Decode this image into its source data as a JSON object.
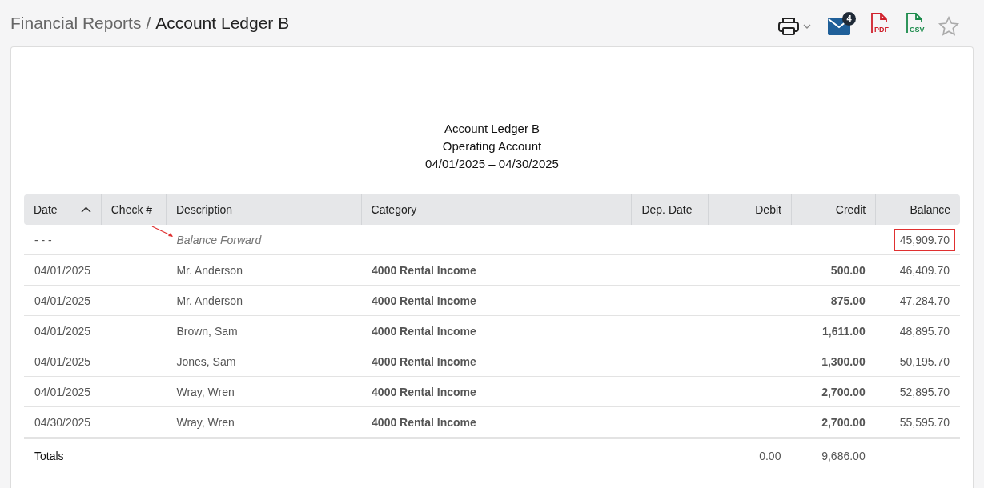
{
  "breadcrumb": {
    "parent": "Financial Reports",
    "separator": "/",
    "current": "Account Ledger B"
  },
  "toolbar": {
    "mail_count": "4",
    "pdf_label": "PDF",
    "csv_label": "CSV",
    "favorite": false
  },
  "report": {
    "title": "Account Ledger B",
    "subtitle": "Operating Account",
    "period": "04/01/2025 – 04/30/2025"
  },
  "table": {
    "columns": [
      {
        "label": "Date",
        "sorted": true
      },
      {
        "label": "Check #",
        "sorted": false
      },
      {
        "label": "Description",
        "sorted": false
      },
      {
        "label": "Category",
        "sorted": false
      },
      {
        "label": "Dep. Date",
        "sorted": false
      },
      {
        "label": "Debit",
        "sorted": false
      },
      {
        "label": "Credit",
        "sorted": false
      },
      {
        "label": "Balance",
        "sorted": false
      }
    ],
    "rows": [
      {
        "kind": "forward",
        "date": "- - -",
        "description": "Balance Forward",
        "balance": "45,909.70",
        "highlighted": true
      },
      {
        "kind": "entry",
        "date": "04/01/2025",
        "description": "Mr. Anderson",
        "category": "4000 Rental Income",
        "credit": "500.00",
        "balance": "46,409.70",
        "highlighted": false
      },
      {
        "kind": "entry",
        "date": "04/01/2025",
        "description": "Mr. Anderson",
        "category": "4000 Rental Income",
        "credit": "875.00",
        "balance": "47,284.70",
        "highlighted": false
      },
      {
        "kind": "entry",
        "date": "04/01/2025",
        "description": "Brown, Sam",
        "category": "4000 Rental Income",
        "credit": "1,611.00",
        "balance": "48,895.70",
        "highlighted": false
      },
      {
        "kind": "entry",
        "date": "04/01/2025",
        "description": "Jones, Sam",
        "category": "4000 Rental Income",
        "credit": "1,300.00",
        "balance": "50,195.70",
        "highlighted": false
      },
      {
        "kind": "entry",
        "date": "04/01/2025",
        "description": "Wray, Wren",
        "category": "4000 Rental Income",
        "credit": "2,700.00",
        "balance": "52,895.70",
        "highlighted": false
      },
      {
        "kind": "entry",
        "date": "04/30/2025",
        "description": "Wray, Wren",
        "category": "4000 Rental Income",
        "credit": "2,700.00",
        "balance": "55,595.70",
        "highlighted": false
      }
    ],
    "totals": {
      "label": "Totals",
      "debit": "0.00",
      "credit": "9,686.00"
    }
  }
}
